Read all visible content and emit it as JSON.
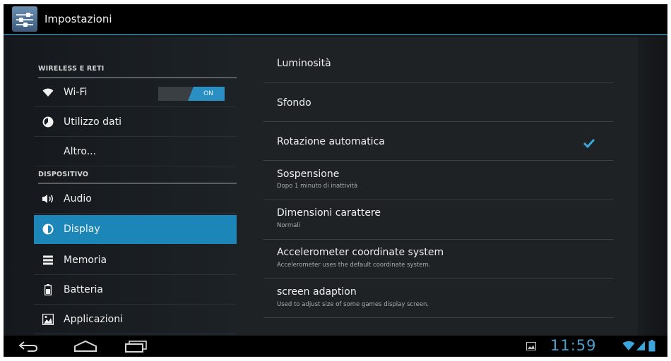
{
  "action_bar": {
    "title": "Impostazioni",
    "app_icon": "settings-sliders-icon"
  },
  "sidebar": {
    "sections": [
      {
        "header": "WIRELESS E RETI"
      },
      {
        "header": "DISPOSITIVO"
      }
    ],
    "items": [
      {
        "label": "Wi-Fi",
        "icon": "wifi-icon"
      },
      {
        "label": "Utilizzo dati",
        "icon": "data-usage-icon"
      },
      {
        "label": "Altro...",
        "icon": ""
      },
      {
        "label": "Audio",
        "icon": "speaker-icon"
      },
      {
        "label": "Display",
        "icon": "display-icon",
        "selected": true
      },
      {
        "label": "Memoria",
        "icon": "storage-icon"
      },
      {
        "label": "Batteria",
        "icon": "battery-icon"
      },
      {
        "label": "Applicazioni",
        "icon": "apps-icon"
      }
    ],
    "wifi_toggle": {
      "state_label": "ON"
    }
  },
  "display_settings": [
    {
      "title": "Luminosità",
      "summary": ""
    },
    {
      "title": "Sfondo",
      "summary": ""
    },
    {
      "title": "Rotazione automatica",
      "summary": "",
      "checked": true
    },
    {
      "title": "Sospensione",
      "summary": "Dopo 1 minuto di inattività"
    },
    {
      "title": "Dimensioni carattere",
      "summary": "Normali"
    },
    {
      "title": "Accelerometer coordinate system",
      "summary": "Accelerometer uses the default coordinate system."
    },
    {
      "title": "screen adaption",
      "summary": "Used to adjust size of some games display screen."
    }
  ],
  "system_bar": {
    "clock": "11:59",
    "icons": [
      "back-icon",
      "home-icon",
      "recent-apps-icon",
      "gallery-icon",
      "wifi-status-icon",
      "signal-icon",
      "battery-status-icon"
    ]
  },
  "colors": {
    "accent": "#1d86b8",
    "clock": "#4aa0cf",
    "background": "#1e2225"
  }
}
